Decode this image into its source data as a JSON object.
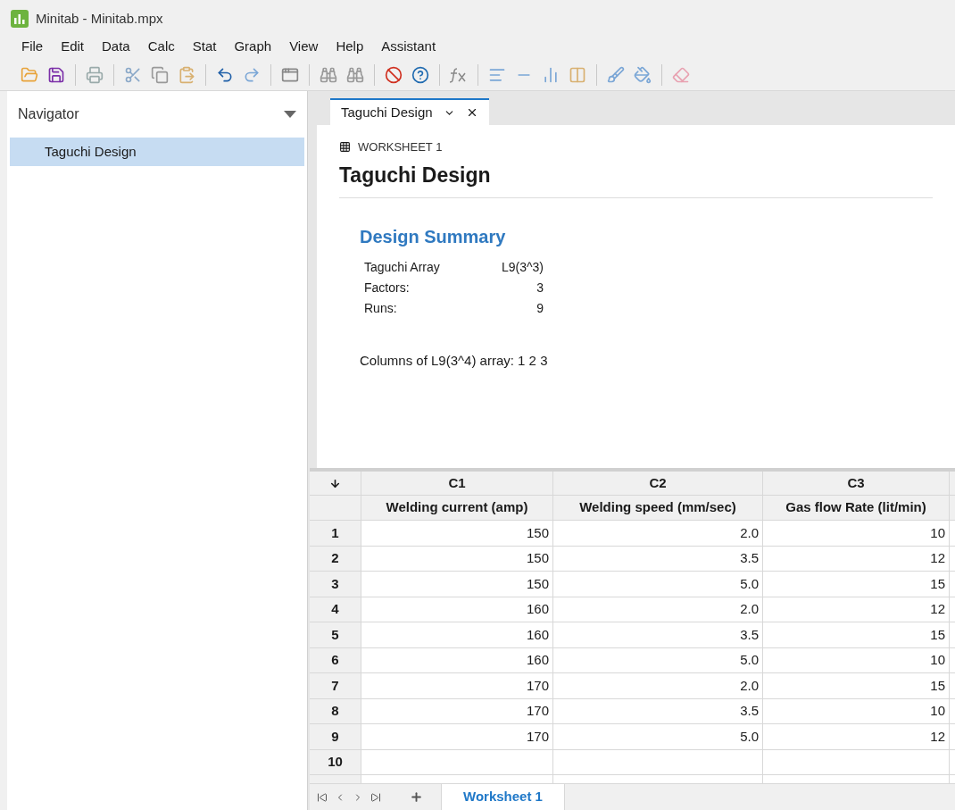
{
  "window": {
    "title": "Minitab - Minitab.mpx"
  },
  "menu": [
    "File",
    "Edit",
    "Data",
    "Calc",
    "Stat",
    "Graph",
    "View",
    "Help",
    "Assistant"
  ],
  "navigator": {
    "title": "Navigator",
    "items": [
      {
        "label": "Taguchi Design",
        "selected": true
      }
    ]
  },
  "tabs": [
    {
      "label": "Taguchi Design",
      "selected": true
    }
  ],
  "output": {
    "worksheet": "WORKSHEET 1",
    "title": "Taguchi Design",
    "section": "Design Summary",
    "summary": [
      {
        "label": "Taguchi Array",
        "value": "L9(3^3)"
      },
      {
        "label": "Factors:",
        "value": "3"
      },
      {
        "label": "Runs:",
        "value": "9"
      }
    ],
    "note": "Columns of L9(3^4) array: 1 2 3"
  },
  "table": {
    "columns": [
      {
        "id": "C1",
        "name": "Welding current (amp)"
      },
      {
        "id": "C2",
        "name": "Welding speed (mm/sec)"
      },
      {
        "id": "C3",
        "name": "Gas flow Rate (lit/min)"
      }
    ],
    "rows": [
      {
        "n": "1",
        "cells": [
          "150",
          "2.0",
          "10"
        ]
      },
      {
        "n": "2",
        "cells": [
          "150",
          "3.5",
          "12"
        ]
      },
      {
        "n": "3",
        "cells": [
          "150",
          "5.0",
          "15"
        ]
      },
      {
        "n": "4",
        "cells": [
          "160",
          "2.0",
          "12"
        ]
      },
      {
        "n": "5",
        "cells": [
          "160",
          "3.5",
          "15"
        ]
      },
      {
        "n": "6",
        "cells": [
          "160",
          "5.0",
          "10"
        ]
      },
      {
        "n": "7",
        "cells": [
          "170",
          "2.0",
          "15"
        ]
      },
      {
        "n": "8",
        "cells": [
          "170",
          "3.5",
          "10"
        ]
      },
      {
        "n": "9",
        "cells": [
          "170",
          "5.0",
          "12"
        ]
      },
      {
        "n": "10",
        "cells": []
      }
    ]
  },
  "sheet_tabs": [
    {
      "label": "Worksheet 1",
      "selected": true
    }
  ]
}
